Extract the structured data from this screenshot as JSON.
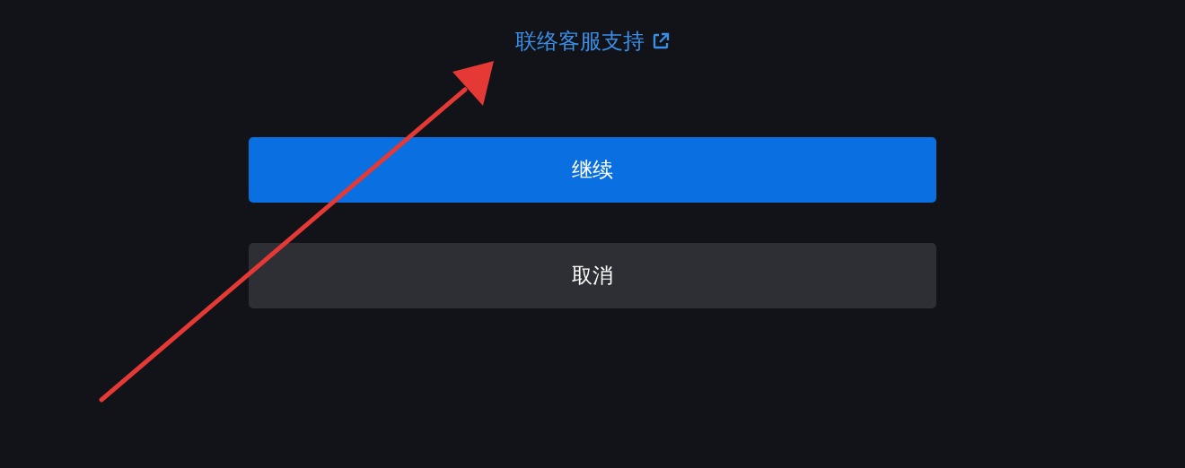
{
  "support_link": {
    "label": "联络客服支持"
  },
  "buttons": [
    {
      "label": "继续",
      "kind": "primary"
    },
    {
      "label": "取消",
      "kind": "secondary"
    }
  ]
}
